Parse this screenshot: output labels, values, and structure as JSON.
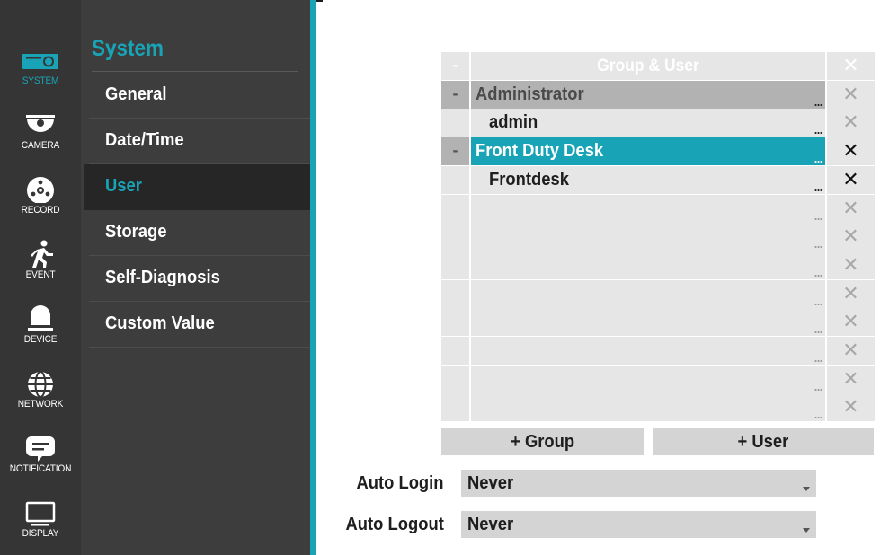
{
  "nav": {
    "items": [
      {
        "label": "SYSTEM",
        "icon": "system-icon",
        "active": true
      },
      {
        "label": "CAMERA",
        "icon": "camera-icon",
        "active": false
      },
      {
        "label": "RECORD",
        "icon": "record-icon",
        "active": false
      },
      {
        "label": "EVENT",
        "icon": "event-icon",
        "active": false
      },
      {
        "label": "DEVICE",
        "icon": "device-icon",
        "active": false
      },
      {
        "label": "NETWORK",
        "icon": "network-icon",
        "active": false
      },
      {
        "label": "NOTIFICATION",
        "icon": "notification-icon",
        "active": false
      },
      {
        "label": "DISPLAY",
        "icon": "display-icon",
        "active": false
      }
    ]
  },
  "submenu": {
    "title": "System",
    "items": [
      {
        "label": "General",
        "active": false
      },
      {
        "label": "Date/Time",
        "active": false
      },
      {
        "label": "User",
        "active": true
      },
      {
        "label": "Storage",
        "active": false
      },
      {
        "label": "Self-Diagnosis",
        "active": false
      },
      {
        "label": "Custom Value",
        "active": false
      }
    ]
  },
  "table": {
    "header": {
      "collapse": "-",
      "title": "Group & User",
      "delete": "✕"
    },
    "rows": [
      {
        "kind": "group",
        "toggle": "-",
        "name": "Administrator",
        "delete": "✕",
        "selected": false
      },
      {
        "kind": "user",
        "toggle": "",
        "name": "admin",
        "delete": "✕",
        "selected": false
      },
      {
        "kind": "group",
        "toggle": "-",
        "name": "Front Duty Desk",
        "delete": "✕",
        "selected": true
      },
      {
        "kind": "user",
        "toggle": "",
        "name": "Frontdesk",
        "delete": "✕",
        "selected": false
      },
      {
        "kind": "empty",
        "toggle": "",
        "name": "",
        "delete": "✕",
        "selected": false
      },
      {
        "kind": "empty",
        "toggle": "",
        "name": "",
        "delete": "✕",
        "selected": false
      },
      {
        "kind": "empty",
        "toggle": "",
        "name": "",
        "delete": "✕",
        "selected": false
      },
      {
        "kind": "empty",
        "toggle": "",
        "name": "",
        "delete": "✕",
        "selected": false
      },
      {
        "kind": "empty",
        "toggle": "",
        "name": "",
        "delete": "✕",
        "selected": false
      },
      {
        "kind": "empty",
        "toggle": "",
        "name": "",
        "delete": "✕",
        "selected": false
      },
      {
        "kind": "empty",
        "toggle": "",
        "name": "",
        "delete": "✕",
        "selected": false
      },
      {
        "kind": "empty",
        "toggle": "",
        "name": "",
        "delete": "✕",
        "selected": false
      }
    ]
  },
  "buttons": {
    "add_group": "+ Group",
    "add_user": "+ User"
  },
  "fields": {
    "auto_login": {
      "label": "Auto Login",
      "value": "Never"
    },
    "auto_logout": {
      "label": "Auto Logout",
      "value": "Never"
    }
  },
  "colors": {
    "accent": "#18a4b6",
    "nav_bg": "#353535",
    "submenu_bg": "#3d3d3d"
  }
}
